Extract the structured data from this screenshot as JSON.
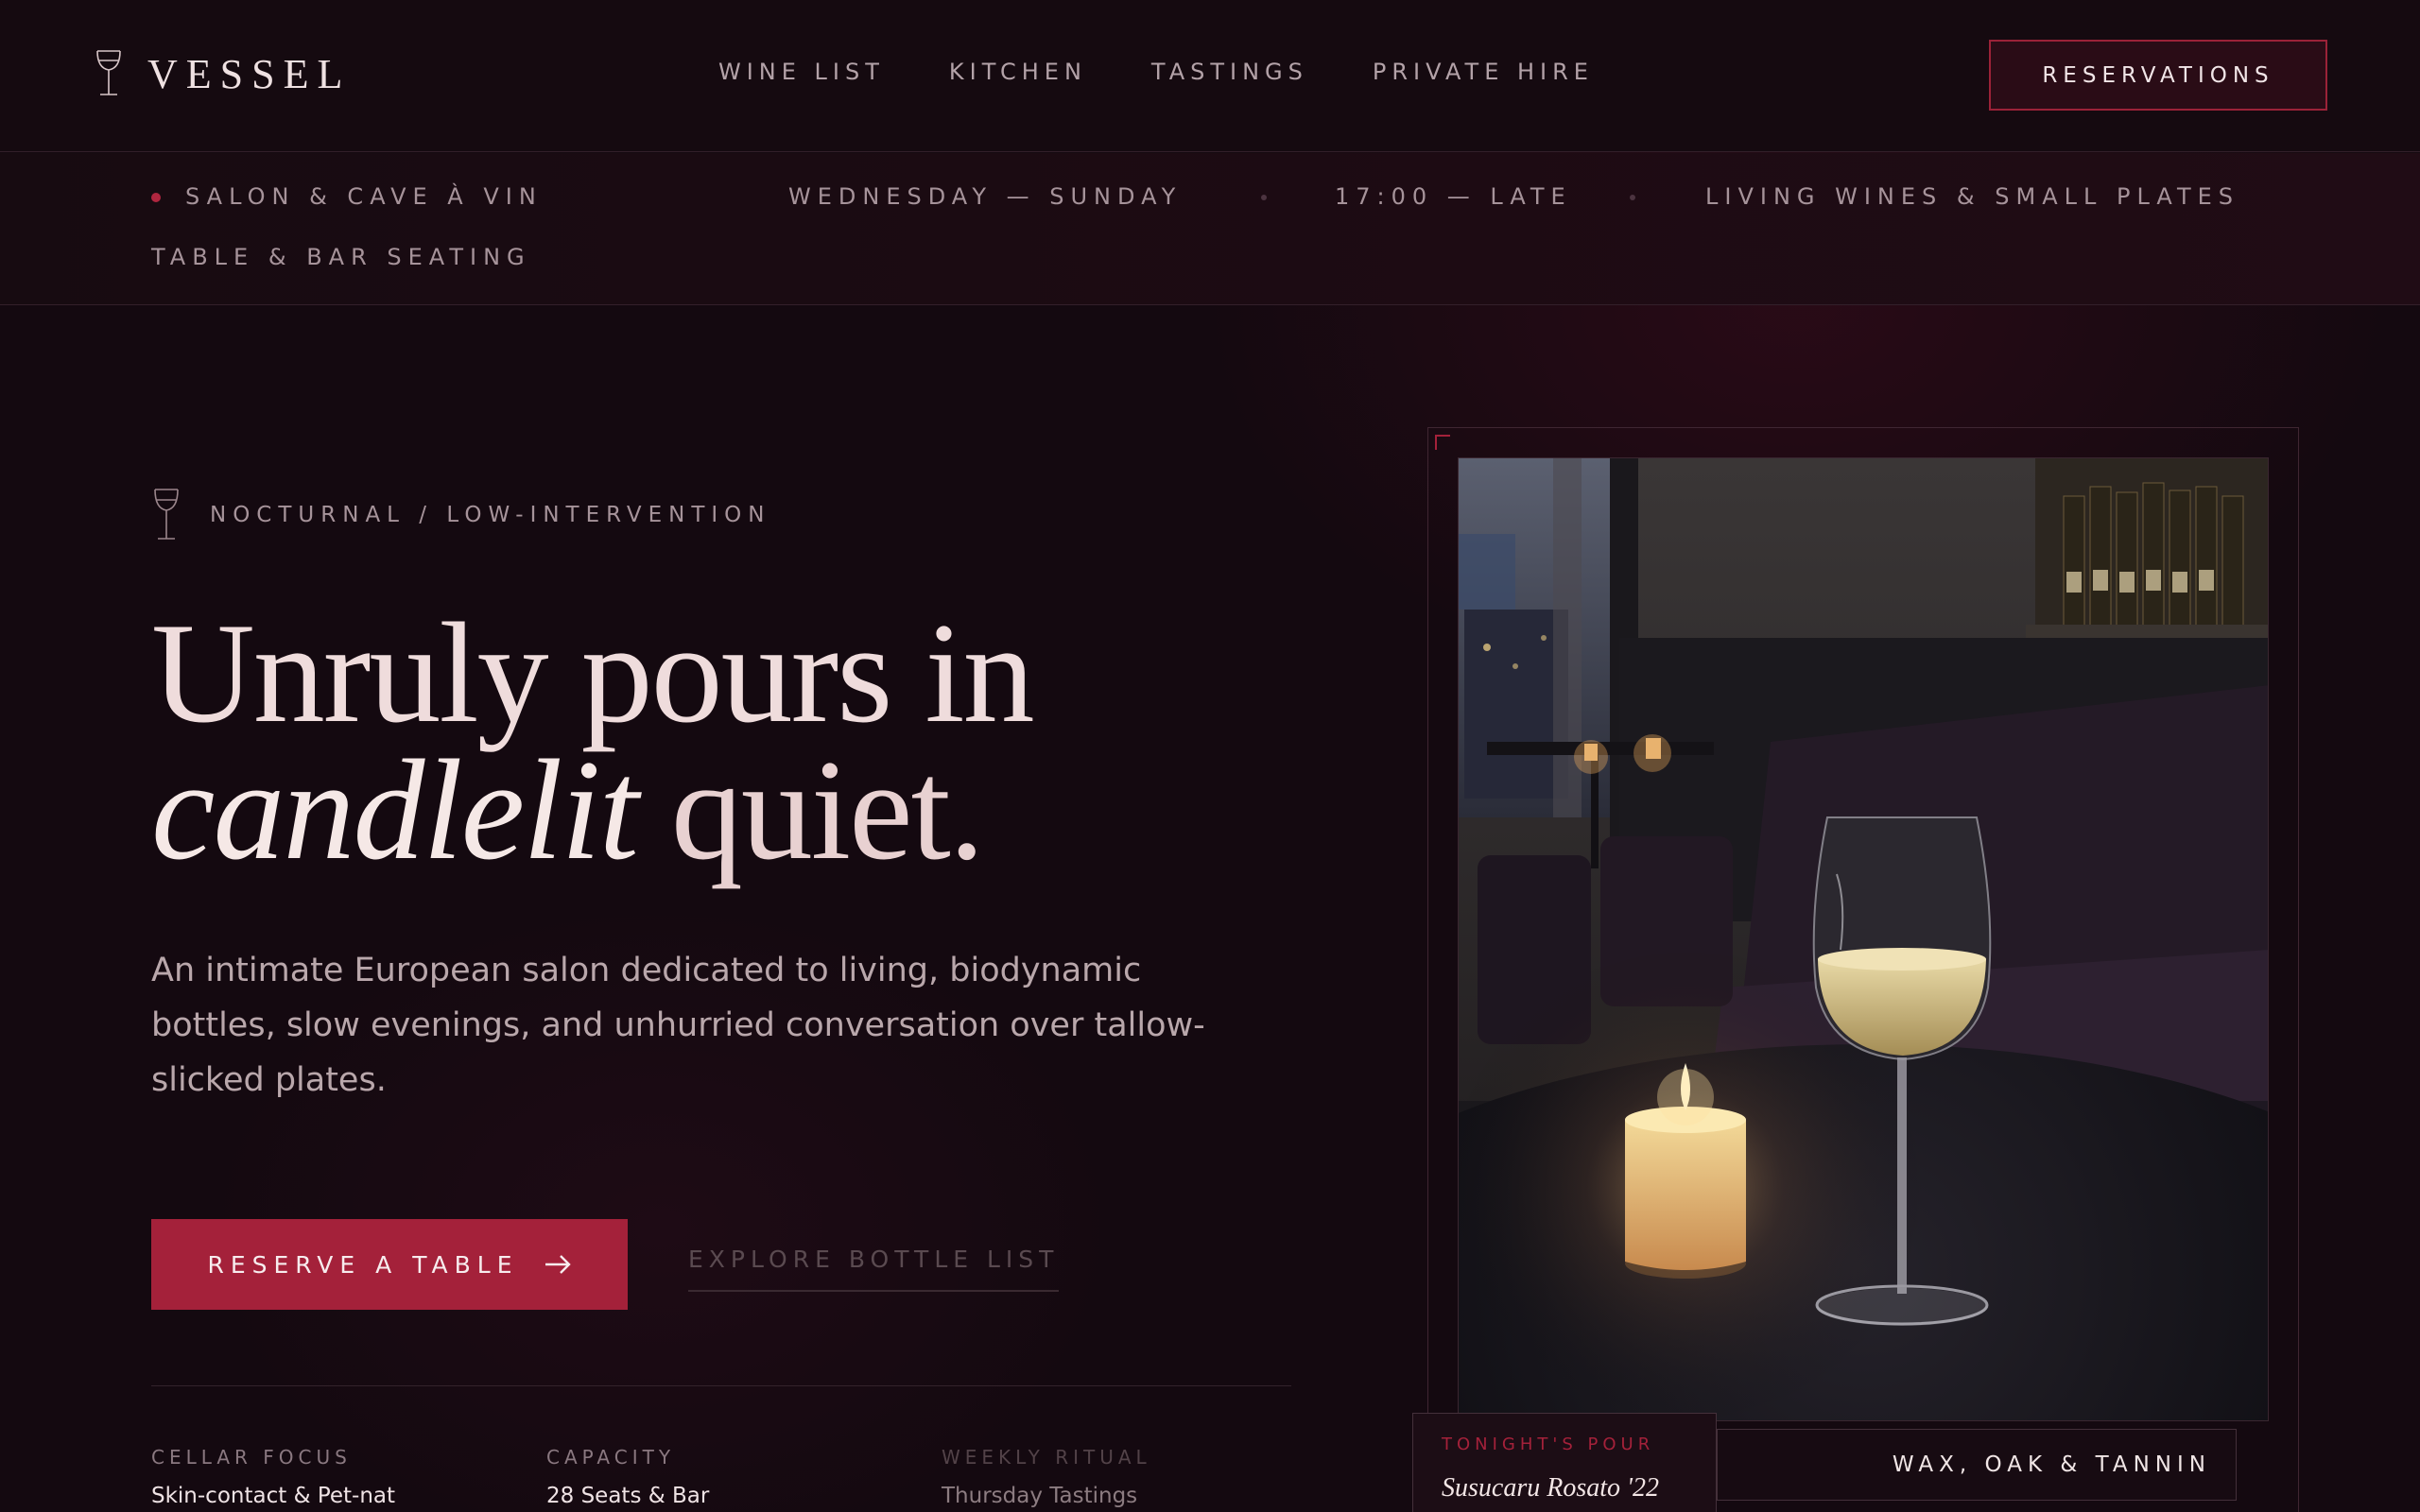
{
  "brand": {
    "name": "VESSEL"
  },
  "nav": {
    "links": [
      "WINE LIST",
      "KITCHEN",
      "TASTINGS",
      "PRIVATE HIRE"
    ],
    "cta": "RESERVATIONS"
  },
  "infobar": {
    "venue_type": "SALON & CAVE À VIN",
    "days": "WEDNESDAY — SUNDAY",
    "hours": "17:00 — LATE",
    "concept": "LIVING WINES & SMALL PLATES",
    "seating": "TABLE & BAR SEATING"
  },
  "hero": {
    "eyebrow": "NOCTURNAL / LOW-INTERVENTION",
    "headline_line1": "Unruly pours in",
    "headline_italic": "candlelit",
    "headline_rest": " quiet.",
    "lede": "An intimate European salon dedicated to living, biodynamic bottles, slow evenings, and unhurried conversation over tallow-slicked plates.",
    "primary_cta": "RESERVE A TABLE",
    "secondary_cta": "EXPLORE BOTTLE LIST"
  },
  "stats": [
    {
      "label": "CELLAR FOCUS",
      "value": "Skin-contact & Pet-nat"
    },
    {
      "label": "CAPACITY",
      "value": "28 Seats & Bar"
    },
    {
      "label": "WEEKLY RITUAL",
      "value": "Thursday Tastings"
    }
  ],
  "feature": {
    "pour_label": "TONIGHT'S POUR",
    "pour_name": "Susucaru Rosato '22",
    "tag": "WAX, OAK & TANNIN"
  },
  "colors": {
    "accent": "#a4213a",
    "background": "#140910",
    "text": "#efdcdc"
  }
}
